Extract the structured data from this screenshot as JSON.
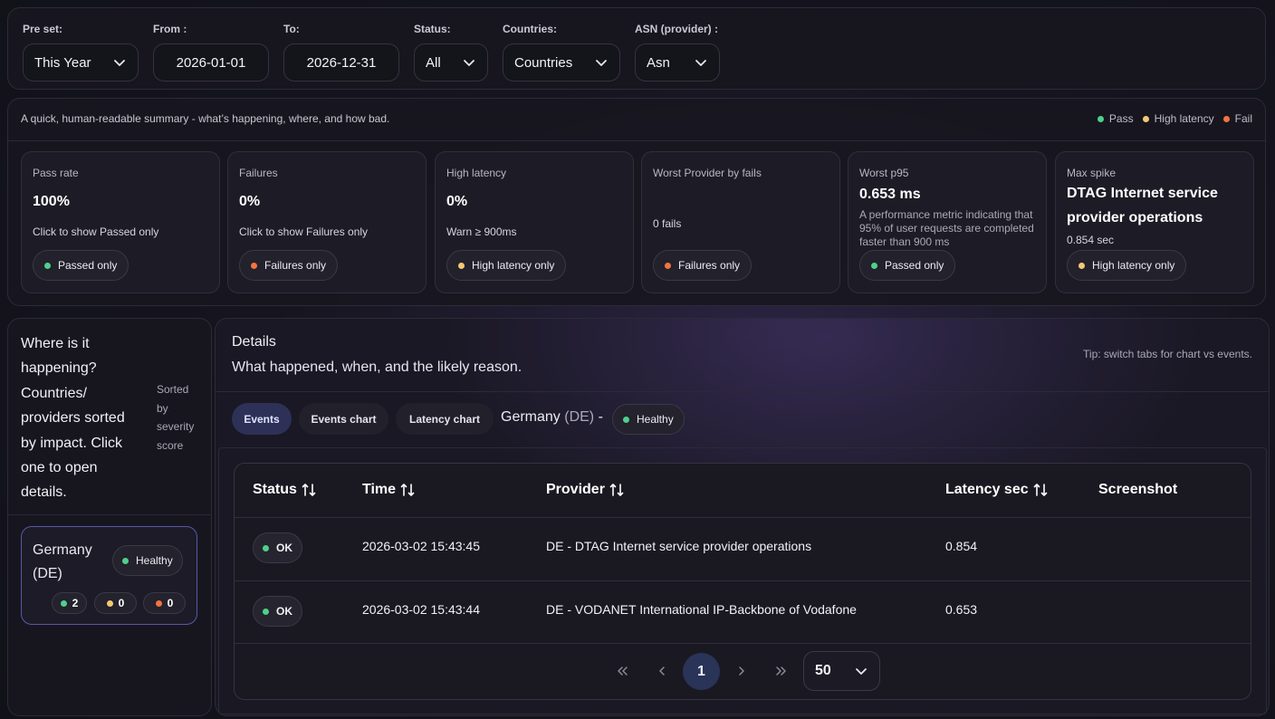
{
  "filters": {
    "preset": {
      "label": "Pre set:",
      "value": "This Year"
    },
    "from": {
      "label": "From :",
      "value": "2026-01-01"
    },
    "to": {
      "label": "To:",
      "value": "2026-12-31"
    },
    "status": {
      "label": "Status:",
      "value": "All"
    },
    "countries": {
      "label": "Countries:",
      "value": "Countries"
    },
    "asn": {
      "label": "ASN (provider) :",
      "value": "Asn"
    }
  },
  "summary": {
    "description": "A quick, human-readable summary - what’s happening, where, and how bad.",
    "legend": {
      "pass": "Pass",
      "high_latency": "High latency",
      "fail": "Fail"
    },
    "colors": {
      "pass": "#4fd08a",
      "warn": "#f5c871",
      "fail": "#f2733f"
    },
    "cards": {
      "pass_rate": {
        "title": "Pass rate",
        "value": "100%",
        "desc": "Click to show Passed only",
        "button": "Passed only"
      },
      "failures": {
        "title": "Failures",
        "value": "0%",
        "desc": "Click to show Failures only",
        "button": "Failures only"
      },
      "high_latency": {
        "title": "High latency",
        "value": "0%",
        "desc": "Warn ≥ 900ms",
        "button": "High latency only"
      },
      "worst_provider": {
        "title": "Worst Provider by fails",
        "desc": "0 fails",
        "button": "Failures only"
      },
      "worst_p95": {
        "title": "Worst p95",
        "value": "0.653 ms",
        "note": "A performance metric indicating that 95% of user requests are completed faster than 900 ms",
        "button": "Passed only"
      },
      "max_spike": {
        "title": "Max spike",
        "value": "DTAG Internet service provider operations",
        "sub": "0.854 sec",
        "button": "High latency only"
      }
    }
  },
  "left": {
    "heading": "Where is it happening? Countries/ providers sorted by impact. Click one to open details.",
    "sort_note": "Sorted by severity score",
    "countries": [
      {
        "name": "Germany (DE)",
        "health": "Healthy",
        "pass": "2",
        "warn": "0",
        "fail": "0"
      }
    ]
  },
  "details": {
    "title": "Details",
    "subtitle": "What happened, when, and the likely reason.",
    "tip": "Tip: switch tabs for chart vs events.",
    "tabs": [
      "Events",
      "Events chart",
      "Latency chart"
    ],
    "active_tab": "Events",
    "country": "Germany",
    "country_code": "(DE)",
    "separator": "-",
    "health": "Healthy",
    "table": {
      "columns": [
        "Status",
        "Time",
        "Provider",
        "Latency sec",
        "Screenshot"
      ],
      "rows": [
        {
          "status": "OK",
          "time": "2026-03-02 15:43:45",
          "provider": "DE - DTAG Internet service provider operations",
          "latency": "0.854",
          "screenshot": ""
        },
        {
          "status": "OK",
          "time": "2026-03-02 15:43:44",
          "provider": "DE - VODANET International IP-Backbone of Vodafone",
          "latency": "0.653",
          "screenshot": ""
        }
      ]
    },
    "pagination": {
      "current": "1",
      "page_size": "50"
    }
  }
}
